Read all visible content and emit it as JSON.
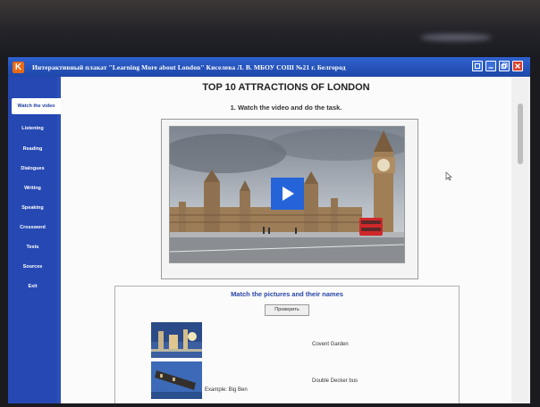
{
  "window": {
    "app_icon_letter": "K",
    "title": "Интерактивный плакат \"Learning More about London\" Киселева Л. В. МБОУ СОШ №21 г. Белгород",
    "buttons": [
      "help",
      "minimize",
      "restore",
      "close"
    ]
  },
  "sidebar": {
    "items": [
      {
        "label": "Watch the video",
        "active": true
      },
      {
        "label": "Listening"
      },
      {
        "label": "Reading"
      },
      {
        "label": "Dialogues"
      },
      {
        "label": "Writing"
      },
      {
        "label": "Speaking"
      },
      {
        "label": "Crossword"
      },
      {
        "label": "Tests"
      },
      {
        "label": "Sources"
      },
      {
        "label": "Exit"
      }
    ]
  },
  "main": {
    "title": "TOP 10 ATTRACTIONS OF LONDON",
    "task": "1. Watch the video and do the task.",
    "video": {
      "thumbnail": "Houses of Parliament and Big Ben"
    }
  },
  "match": {
    "title": "Match the pictures and their names",
    "check_button": "Проверить",
    "example": "Example: Big Ben",
    "names": [
      "Covent Garden",
      "Double Decker bus"
    ]
  },
  "colors": {
    "sidebar": "#2548b3",
    "titlebar": "#1e47a8",
    "play_button": "#2563d9",
    "match_title": "#2746a5"
  }
}
